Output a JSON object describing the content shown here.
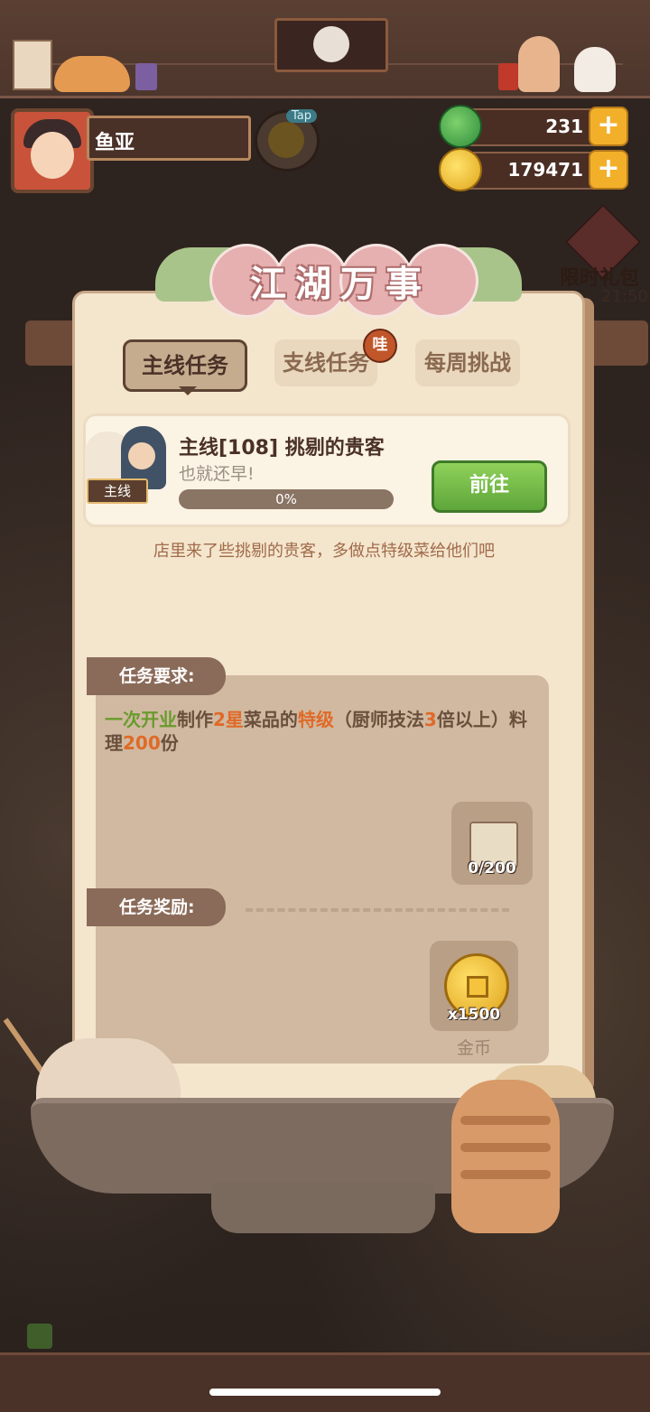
{
  "player": {
    "name": "鱼亚"
  },
  "tap_badge": "Tap",
  "resources": {
    "gems": "231",
    "coins": "179471"
  },
  "side_event": {
    "label": "限时礼包",
    "timer": "21:50"
  },
  "panel": {
    "title": "江湖万事",
    "tabs": [
      {
        "label": "主线任务",
        "active": true
      },
      {
        "label": "支线任务",
        "active": false,
        "badge": "哇"
      },
      {
        "label": "每周挑战",
        "active": false
      }
    ]
  },
  "quest": {
    "tag": "主线",
    "title": "主线[108]  挑剔的贵客",
    "subtitle": "也就还早!",
    "progress_percent": 0,
    "progress_label": "0%",
    "go_button": "前往",
    "description": "店里来了些挑剔的贵客，多做点特级菜给他们吧"
  },
  "requirements": {
    "header": "任务要求:",
    "text_parts": [
      {
        "text": "一次开业",
        "color": "green"
      },
      {
        "text": "制作",
        "color": "normal"
      },
      {
        "text": "2星",
        "color": "orange"
      },
      {
        "text": "菜品的",
        "color": "normal"
      },
      {
        "text": "特级",
        "color": "orange"
      },
      {
        "text": "（厨师技法",
        "color": "normal"
      },
      {
        "text": "3",
        "color": "orange"
      },
      {
        "text": "倍以上）料理",
        "color": "normal"
      },
      {
        "text": "200",
        "color": "orange"
      },
      {
        "text": "份",
        "color": "normal"
      }
    ],
    "item_count": "0/200"
  },
  "rewards": {
    "header": "任务奖励:",
    "items": [
      {
        "name": "金币",
        "count": "x1500",
        "icon": "coin-icon"
      }
    ]
  },
  "colors": {
    "accent_green": "#6a9a2e",
    "accent_orange": "#e06a28"
  }
}
